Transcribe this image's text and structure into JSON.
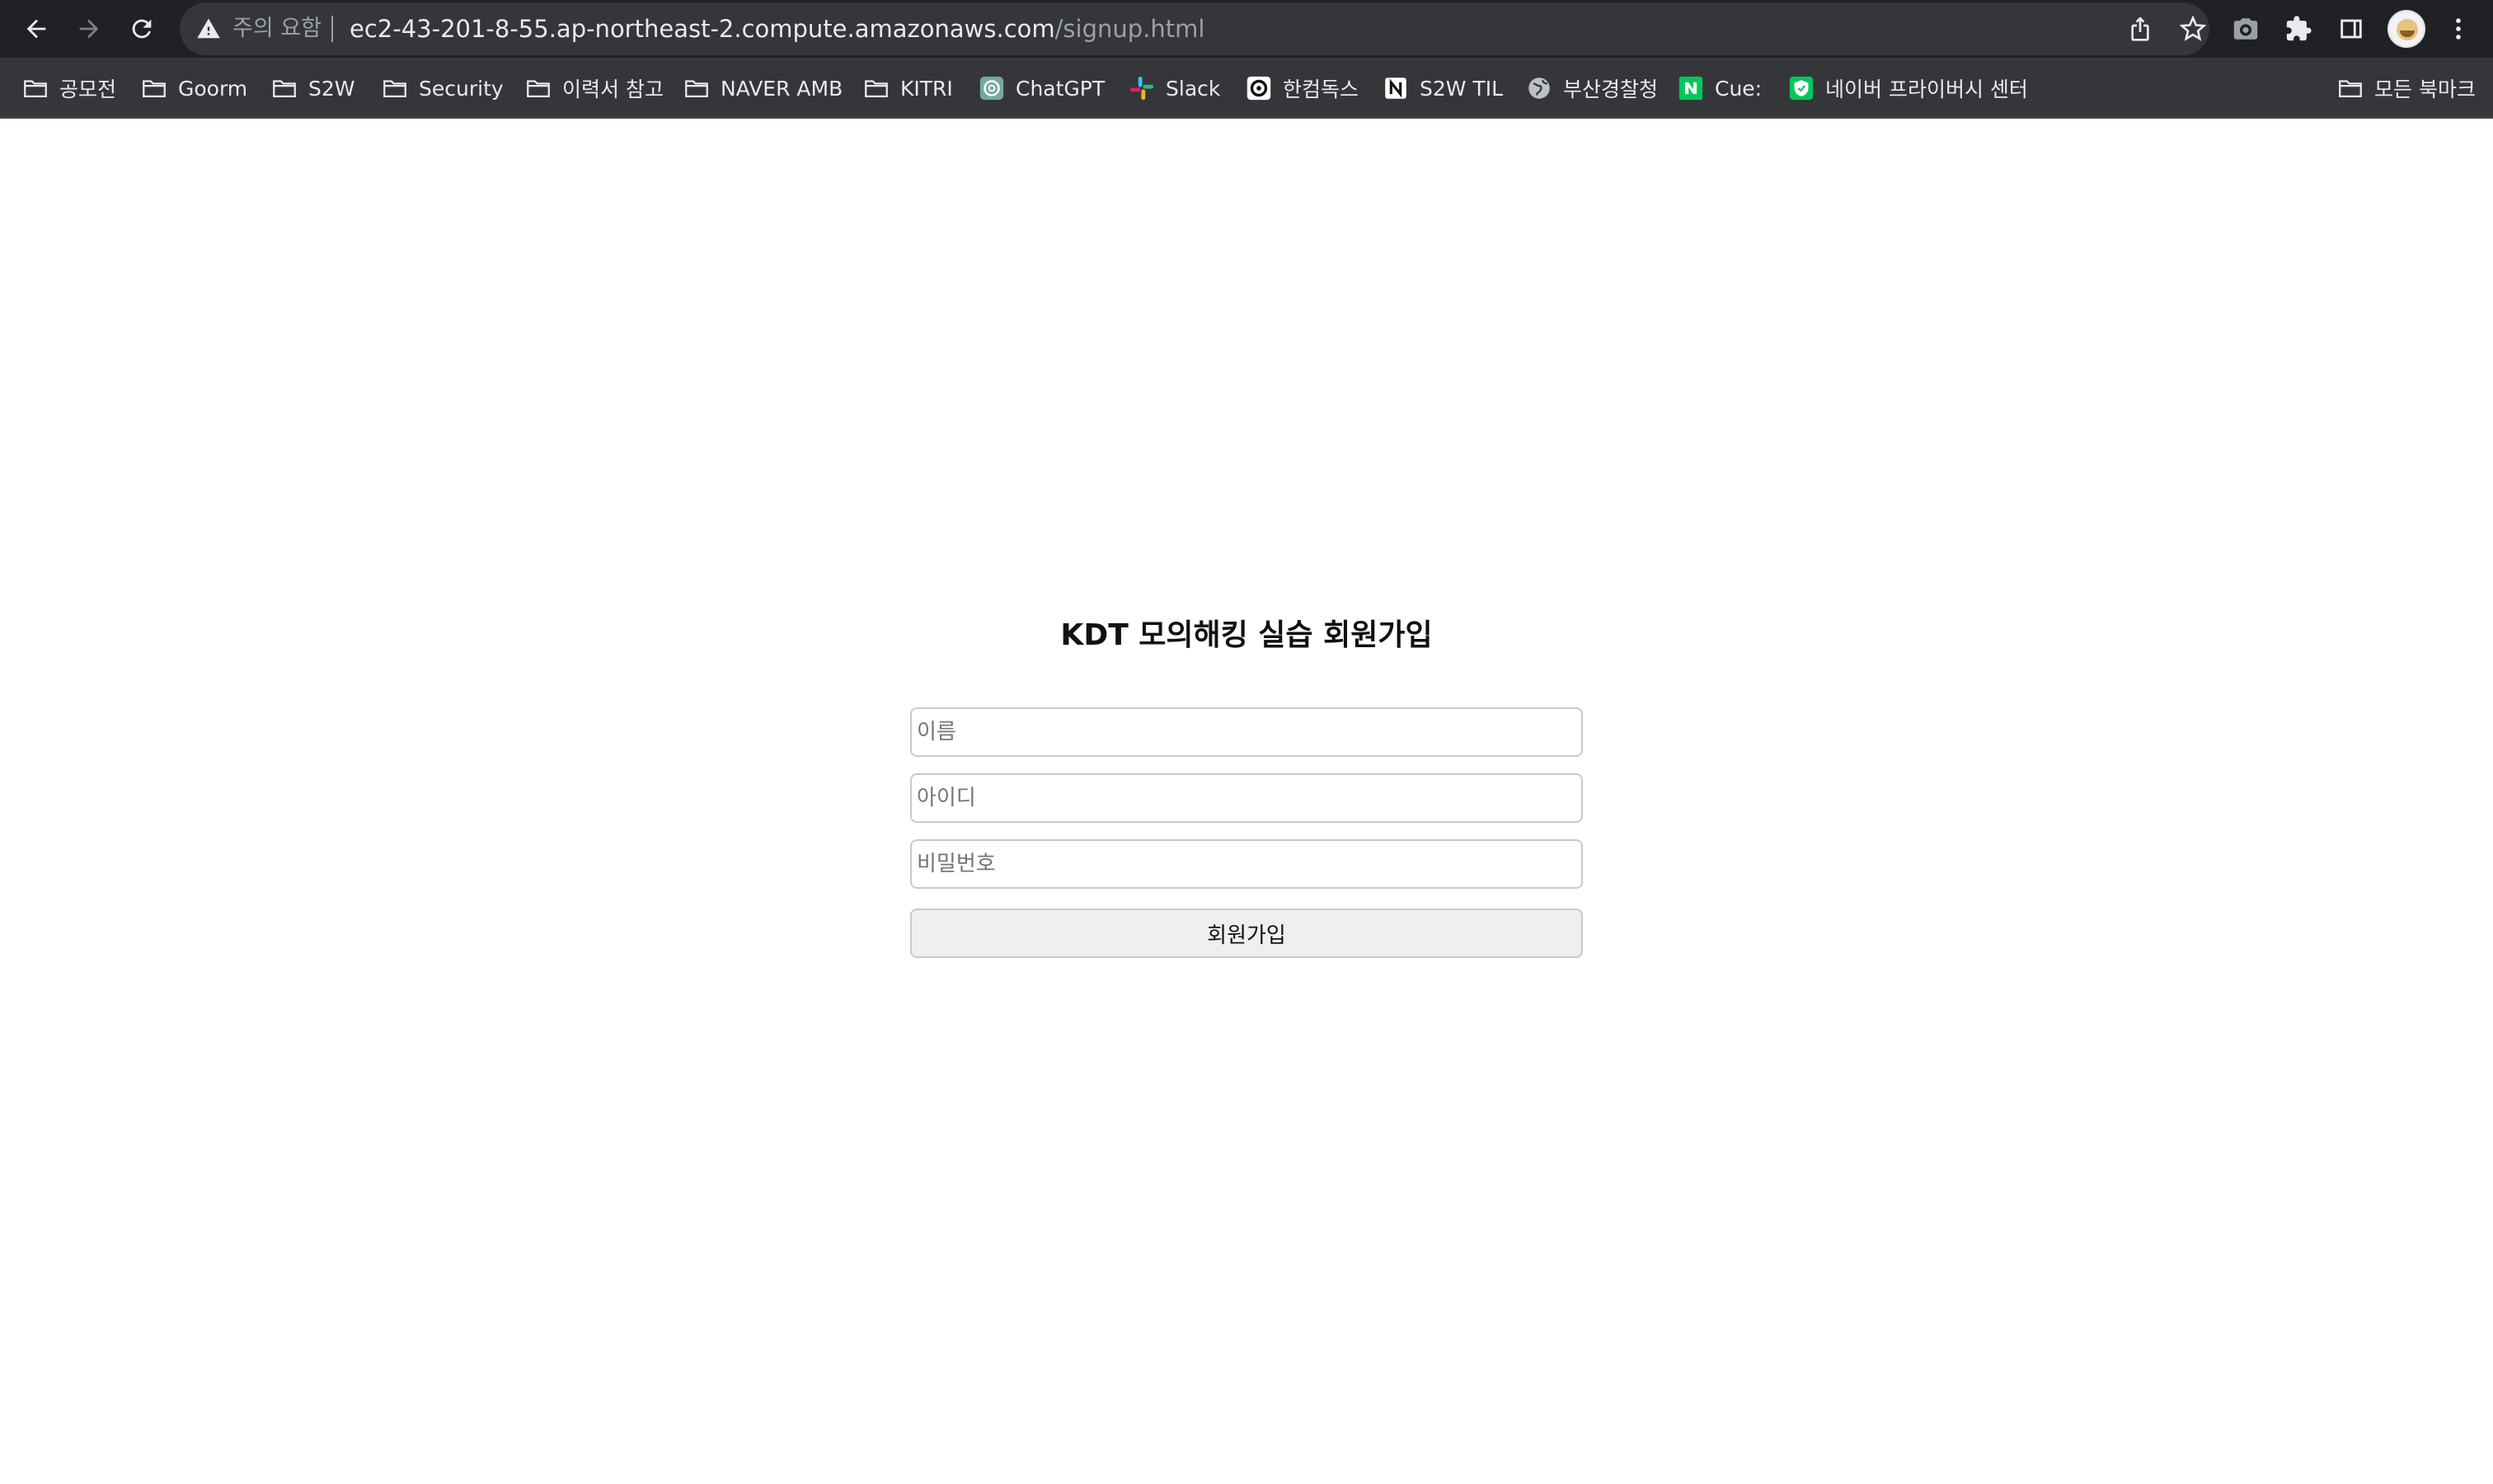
{
  "browser": {
    "security_status": "주의 요함",
    "url_host": "ec2-43-201-8-55.ap-northeast-2.compute.amazonaws.com",
    "url_path": "/signup.html",
    "icons": {
      "back": "back-arrow-icon",
      "forward": "forward-arrow-icon",
      "reload": "reload-icon",
      "share": "share-icon",
      "bookmark_star": "star-icon",
      "camera": "camera-icon",
      "extensions": "puzzle-icon",
      "side_panel": "side-panel-icon",
      "menu": "kebab-menu-icon"
    }
  },
  "bookmarks": {
    "items": [
      {
        "label": "공모전",
        "icon": "folder-icon"
      },
      {
        "label": "Goorm",
        "icon": "folder-icon"
      },
      {
        "label": "S2W",
        "icon": "folder-icon"
      },
      {
        "label": "Security",
        "icon": "folder-icon"
      },
      {
        "label": "이력서 참고",
        "icon": "folder-icon"
      },
      {
        "label": "NAVER AMB",
        "icon": "folder-icon"
      },
      {
        "label": "KITRI",
        "icon": "folder-icon"
      },
      {
        "label": "ChatGPT",
        "icon": "chatgpt-icon"
      },
      {
        "label": "Slack",
        "icon": "slack-icon"
      },
      {
        "label": "한컴독스",
        "icon": "hancom-icon"
      },
      {
        "label": "S2W TIL",
        "icon": "notion-icon"
      },
      {
        "label": "부산경찰청",
        "icon": "globe-icon"
      },
      {
        "label": "Cue:",
        "icon": "naver-icon"
      },
      {
        "label": "네이버 프라이버시 센터",
        "icon": "shield-icon"
      }
    ],
    "all_bookmarks": {
      "label": "모든 북마크",
      "icon": "folder-icon"
    }
  },
  "signup": {
    "title": "KDT 모의해킹 실습 회원가입",
    "name_placeholder": "이름",
    "id_placeholder": "아이디",
    "password_placeholder": "비밀번호",
    "submit_label": "회원가입"
  }
}
